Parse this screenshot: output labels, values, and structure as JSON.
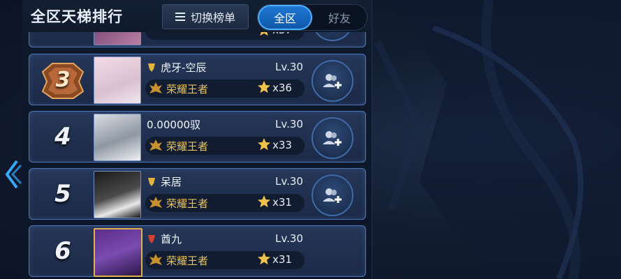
{
  "header": {
    "title": "全区天梯排行",
    "switch_label": "切换榜单",
    "tabs": [
      {
        "label": "全区",
        "active": true
      },
      {
        "label": "好友",
        "active": false
      }
    ]
  },
  "colors": {
    "accent": "#1f79d6",
    "gold": "#e7c25a",
    "row_border": "#4d77b8"
  },
  "icons": {
    "switch": "list-icon",
    "back": "chevron-left-icon",
    "add_friend": "add-friend-icon",
    "star": "star-icon",
    "tier": "tier-badge-icon"
  },
  "partial_top_row": {
    "stars": "x37"
  },
  "rows": [
    {
      "rank": "3",
      "rank_style": "medal",
      "name": "虎牙-空辰",
      "level": "Lv.30",
      "tier": "荣耀王者",
      "stars": "x36",
      "title_badge": "gold"
    },
    {
      "rank": "4",
      "rank_style": "number",
      "name": "0.00000驭",
      "level": "Lv.30",
      "tier": "荣耀王者",
      "stars": "x33",
      "title_badge": ""
    },
    {
      "rank": "5",
      "rank_style": "number",
      "name": "呆居",
      "level": "Lv.30",
      "tier": "荣耀王者",
      "stars": "x31",
      "title_badge": "gold"
    },
    {
      "rank": "6",
      "rank_style": "number",
      "name": "酋九",
      "level": "Lv.30",
      "tier": "荣耀王者",
      "stars": "x31",
      "title_badge": "red"
    }
  ]
}
